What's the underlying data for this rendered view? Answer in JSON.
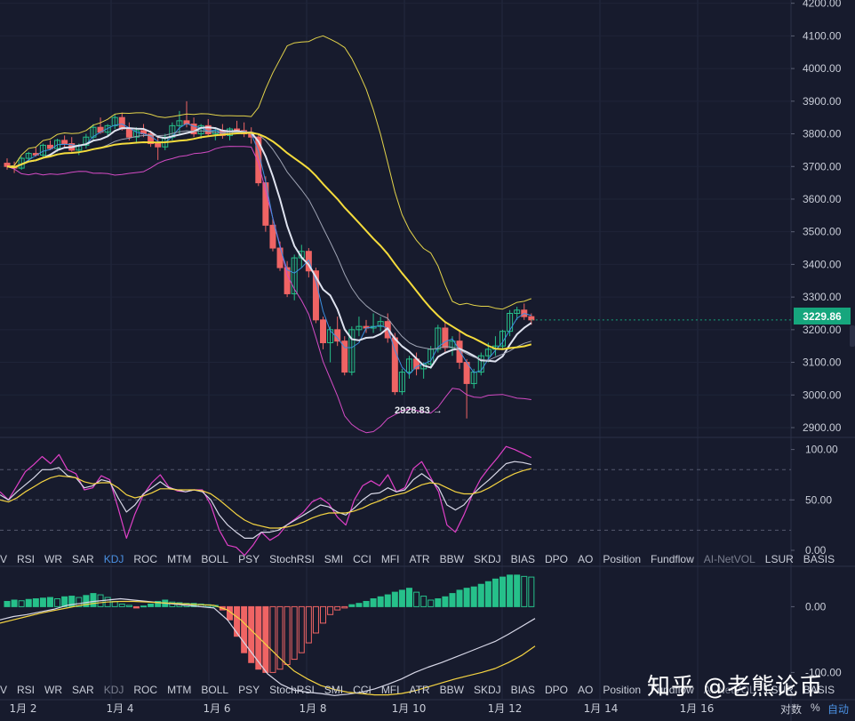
{
  "chart_data": [
    {
      "type": "candlestick",
      "panel": "price",
      "y_ticks": [
        "4200.00",
        "4100.00",
        "4000.00",
        "3900.00",
        "3800.00",
        "3700.00",
        "3600.00",
        "3500.00",
        "3400.00",
        "3300.00",
        "3200.00",
        "3100.00",
        "3000.00",
        "2900.00"
      ],
      "ylim": [
        2870,
        4210
      ],
      "last_price": "3229.86",
      "low_annotation": "2928.83",
      "low_arrow": "→",
      "overlays": [
        "BOLL upper",
        "BOLL lower",
        "MA short",
        "MA mid",
        "MA long",
        "MA slow"
      ],
      "candles_ohlc": [
        [
          3710,
          3725,
          3690,
          3700
        ],
        [
          3700,
          3715,
          3680,
          3695
        ],
        [
          3695,
          3730,
          3690,
          3725
        ],
        [
          3725,
          3745,
          3715,
          3740
        ],
        [
          3740,
          3760,
          3730,
          3735
        ],
        [
          3735,
          3770,
          3725,
          3765
        ],
        [
          3765,
          3780,
          3750,
          3755
        ],
        [
          3755,
          3785,
          3745,
          3780
        ],
        [
          3780,
          3795,
          3760,
          3770
        ],
        [
          3770,
          3790,
          3745,
          3750
        ],
        [
          3750,
          3770,
          3735,
          3765
        ],
        [
          3765,
          3800,
          3755,
          3790
        ],
        [
          3790,
          3830,
          3780,
          3820
        ],
        [
          3820,
          3850,
          3800,
          3805
        ],
        [
          3805,
          3830,
          3790,
          3825
        ],
        [
          3825,
          3860,
          3815,
          3850
        ],
        [
          3850,
          3865,
          3810,
          3815
        ],
        [
          3815,
          3835,
          3780,
          3790
        ],
        [
          3790,
          3820,
          3770,
          3810
        ],
        [
          3810,
          3830,
          3790,
          3800
        ],
        [
          3800,
          3810,
          3760,
          3770
        ],
        [
          3770,
          3790,
          3720,
          3760
        ],
        [
          3760,
          3800,
          3750,
          3790
        ],
        [
          3790,
          3835,
          3780,
          3825
        ],
        [
          3825,
          3870,
          3800,
          3840
        ],
        [
          3840,
          3900,
          3820,
          3830
        ],
        [
          3830,
          3850,
          3790,
          3800
        ],
        [
          3800,
          3830,
          3785,
          3825
        ],
        [
          3825,
          3845,
          3795,
          3800
        ],
        [
          3800,
          3820,
          3780,
          3810
        ],
        [
          3810,
          3830,
          3785,
          3795
        ],
        [
          3795,
          3820,
          3780,
          3815
        ],
        [
          3815,
          3840,
          3800,
          3810
        ],
        [
          3810,
          3835,
          3790,
          3800
        ],
        [
          3800,
          3820,
          3770,
          3790
        ],
        [
          3790,
          3800,
          3640,
          3650
        ],
        [
          3650,
          3670,
          3500,
          3520
        ],
        [
          3520,
          3540,
          3440,
          3450
        ],
        [
          3450,
          3470,
          3380,
          3390
        ],
        [
          3390,
          3410,
          3300,
          3310
        ],
        [
          3310,
          3430,
          3290,
          3420
        ],
        [
          3420,
          3460,
          3390,
          3440
        ],
        [
          3440,
          3450,
          3360,
          3380
        ],
        [
          3380,
          3390,
          3220,
          3230
        ],
        [
          3230,
          3240,
          3140,
          3160
        ],
        [
          3160,
          3210,
          3100,
          3200
        ],
        [
          3200,
          3240,
          3150,
          3165
        ],
        [
          3165,
          3180,
          3060,
          3070
        ],
        [
          3070,
          3210,
          3060,
          3200
        ],
        [
          3200,
          3240,
          3180,
          3210
        ],
        [
          3210,
          3230,
          3190,
          3205
        ],
        [
          3205,
          3250,
          3190,
          3210
        ],
        [
          3210,
          3240,
          3195,
          3225
        ],
        [
          3225,
          3250,
          3160,
          3175
        ],
        [
          3175,
          3190,
          3000,
          3010
        ],
        [
          3010,
          3080,
          3000,
          3070
        ],
        [
          3070,
          3120,
          3050,
          3110
        ],
        [
          3110,
          3130,
          3060,
          3080
        ],
        [
          3080,
          3100,
          3050,
          3095
        ],
        [
          3095,
          3150,
          3080,
          3140
        ],
        [
          3140,
          3215,
          3130,
          3205
        ],
        [
          3205,
          3225,
          3130,
          3145
        ],
        [
          3145,
          3180,
          3120,
          3165
        ],
        [
          3165,
          3200,
          3080,
          3100
        ],
        [
          3100,
          3110,
          2928,
          3035
        ],
        [
          3035,
          3080,
          3020,
          3070
        ],
        [
          3070,
          3130,
          3060,
          3120
        ],
        [
          3120,
          3160,
          3100,
          3140
        ],
        [
          3140,
          3180,
          3120,
          3150
        ],
        [
          3150,
          3200,
          3140,
          3195
        ],
        [
          3195,
          3260,
          3180,
          3250
        ],
        [
          3250,
          3270,
          3230,
          3260
        ],
        [
          3260,
          3280,
          3230,
          3240
        ],
        [
          3240,
          3250,
          3215,
          3230
        ]
      ]
    },
    {
      "type": "line",
      "panel": "oscillator-1",
      "y_ticks": [
        "100.00",
        "50.00",
        "0.00"
      ],
      "ylim": [
        -15,
        112
      ],
      "reference_lines": [
        80,
        50,
        20
      ],
      "series": [
        {
          "color": "#e040c8",
          "values": [
            58,
            50,
            64,
            78,
            85,
            93,
            86,
            95,
            80,
            76,
            60,
            62,
            74,
            70,
            42,
            12,
            36,
            55,
            67,
            75,
            63,
            59,
            58,
            60,
            60,
            45,
            20,
            5,
            3,
            -5,
            5,
            18,
            10,
            15,
            25,
            31,
            38,
            48,
            52,
            46,
            33,
            25,
            50,
            64,
            69,
            64,
            75,
            58,
            62,
            81,
            88,
            73,
            58,
            25,
            18,
            35,
            55,
            71,
            82,
            92,
            103,
            100,
            96,
            92
          ]
        },
        {
          "color": "#d8d8e8",
          "values": [
            55,
            50,
            58,
            65,
            72,
            80,
            80,
            82,
            74,
            72,
            62,
            64,
            70,
            68,
            52,
            38,
            45,
            56,
            62,
            68,
            62,
            60,
            58,
            60,
            58,
            50,
            35,
            25,
            18,
            12,
            12,
            18,
            18,
            20,
            25,
            30,
            35,
            40,
            45,
            43,
            38,
            35,
            42,
            50,
            56,
            57,
            62,
            58,
            60,
            70,
            76,
            70,
            62,
            45,
            40,
            45,
            55,
            63,
            70,
            78,
            86,
            88,
            87,
            85
          ]
        },
        {
          "color": "#f5d442",
          "values": [
            50,
            48,
            52,
            58,
            63,
            68,
            72,
            74,
            73,
            72,
            68,
            66,
            67,
            67,
            62,
            55,
            52,
            54,
            57,
            61,
            61,
            60,
            60,
            60,
            59,
            56,
            50,
            43,
            36,
            30,
            26,
            24,
            22,
            22,
            23,
            25,
            28,
            32,
            35,
            37,
            37,
            37,
            39,
            42,
            46,
            49,
            53,
            55,
            57,
            61,
            65,
            67,
            66,
            62,
            58,
            56,
            56,
            58,
            62,
            67,
            72,
            76,
            79,
            81
          ]
        }
      ]
    },
    {
      "type": "bar+line",
      "panel": "oscillator-2",
      "y_ticks": [
        "0.00",
        "-100.00"
      ],
      "ylim": [
        -140,
        60
      ],
      "histogram": [
        8,
        10,
        9,
        11,
        12,
        13,
        14,
        12,
        15,
        16,
        14,
        17,
        20,
        18,
        14,
        8,
        4,
        2,
        -2,
        1,
        4,
        8,
        10,
        7,
        6,
        5,
        5,
        4,
        3,
        2,
        -5,
        -20,
        -45,
        -70,
        -85,
        -95,
        -100,
        -100,
        -95,
        -88,
        -80,
        -70,
        -55,
        -40,
        -25,
        -12,
        -5,
        -2,
        3,
        5,
        8,
        12,
        15,
        18,
        22,
        25,
        28,
        22,
        16,
        10,
        12,
        15,
        20,
        25,
        28,
        30,
        34,
        38,
        42,
        45,
        48,
        48,
        46,
        45
      ],
      "series": [
        {
          "color": "#d8d8e8",
          "values": [
            -20,
            -15,
            -12,
            -8,
            -4,
            2,
            5,
            8,
            10,
            12,
            10,
            8,
            6,
            4,
            2,
            0,
            -2,
            -20,
            -48,
            -75,
            -102,
            -118,
            -127,
            -130,
            -132,
            -135,
            -133,
            -130,
            -125,
            -118,
            -110,
            -100,
            -92,
            -85,
            -77,
            -69,
            -61,
            -53,
            -42,
            -30,
            -18
          ]
        },
        {
          "color": "#f5d442",
          "values": [
            -25,
            -20,
            -15,
            -10,
            -6,
            -2,
            2,
            5,
            7,
            8,
            8,
            7,
            6,
            5,
            4,
            3,
            2,
            -5,
            -20,
            -40,
            -60,
            -80,
            -98,
            -110,
            -120,
            -126,
            -130,
            -132,
            -134,
            -134,
            -132,
            -128,
            -122,
            -116,
            -110,
            -105,
            -100,
            -94,
            -85,
            -74,
            -60
          ]
        }
      ]
    }
  ],
  "indicator_tabs": [
    "V",
    "RSI",
    "WR",
    "SAR",
    "KDJ",
    "ROC",
    "MTM",
    "BOLL",
    "PSY",
    "StochRSI",
    "SMI",
    "CCI",
    "MFI",
    "ATR",
    "BBW",
    "SKDJ",
    "BIAS",
    "DPO",
    "AO",
    "Position",
    "Fundflow",
    "AI-NetVOL",
    "LSUR",
    "BASIS"
  ],
  "active_tab": "KDJ",
  "dim_tab": "AI-NetVOL",
  "second_tabs_dim": "KDJ",
  "x_ticks": [
    "1月 2",
    "1月 4",
    "1月 6",
    "1月 8",
    "1月 10",
    "1月 12",
    "1月 14",
    "1月 16"
  ],
  "footer": {
    "log_label": "对数",
    "percent_label": "%",
    "auto_label": "自动"
  },
  "watermark": "知乎 @老熊论币"
}
